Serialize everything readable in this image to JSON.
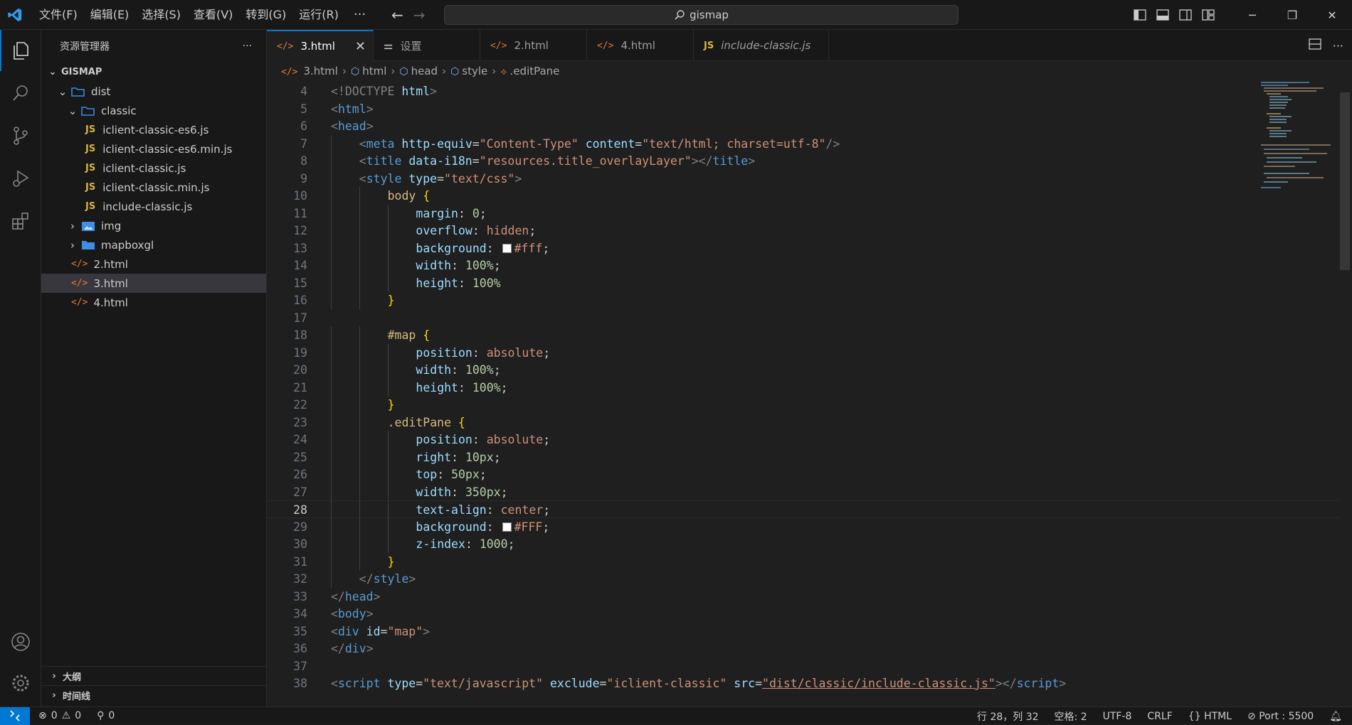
{
  "titlebar": {
    "menu": [
      "文件(F)",
      "编辑(E)",
      "选择(S)",
      "查看(V)",
      "转到(G)",
      "运行(R)"
    ],
    "more": "···",
    "search_text": "gismap"
  },
  "explorer": {
    "title": "资源管理器",
    "more": "···",
    "root": "GISMAP",
    "tree": [
      {
        "label": "dist",
        "type": "folder-open",
        "level": 1
      },
      {
        "label": "classic",
        "type": "folder-open",
        "level": 2
      },
      {
        "label": "iclient-classic-es6.js",
        "type": "js",
        "level": 3
      },
      {
        "label": "iclient-classic-es6.min.js",
        "type": "js",
        "level": 3
      },
      {
        "label": "iclient-classic.js",
        "type": "js",
        "level": 3
      },
      {
        "label": "iclient-classic.min.js",
        "type": "js",
        "level": 3
      },
      {
        "label": "include-classic.js",
        "type": "js",
        "level": 3
      },
      {
        "label": "img",
        "type": "folder-img",
        "level": 2
      },
      {
        "label": "mapboxgl",
        "type": "folder",
        "level": 2
      },
      {
        "label": "2.html",
        "type": "html",
        "level": 2
      },
      {
        "label": "3.html",
        "type": "html",
        "level": 2,
        "selected": true
      },
      {
        "label": "4.html",
        "type": "html",
        "level": 2
      }
    ],
    "outline": "大纲",
    "timeline": "时间线"
  },
  "tabs": [
    {
      "label": "3.html",
      "type": "html",
      "active": true
    },
    {
      "label": "设置",
      "type": "settings"
    },
    {
      "label": "2.html",
      "type": "html"
    },
    {
      "label": "4.html",
      "type": "html"
    },
    {
      "label": "include-classic.js",
      "type": "js",
      "italic": true
    }
  ],
  "breadcrumb": [
    "3.html",
    "html",
    "head",
    "style",
    ".editPane"
  ],
  "editor": {
    "current_line": 28,
    "lines": [
      {
        "n": "4",
        "indent": 0,
        "tokens": [
          [
            "<!DOCTYPE ",
            "#808080"
          ],
          [
            "html",
            "#9cdcfe"
          ],
          [
            ">",
            "#808080"
          ]
        ]
      },
      {
        "n": "5",
        "indent": 0,
        "tokens": [
          [
            "<",
            "#808080"
          ],
          [
            "html",
            "#569cd6"
          ],
          [
            ">",
            "#808080"
          ]
        ]
      },
      {
        "n": "6",
        "indent": 0,
        "tokens": [
          [
            "<",
            "#808080"
          ],
          [
            "head",
            "#569cd6"
          ],
          [
            ">",
            "#808080"
          ]
        ]
      },
      {
        "n": "7",
        "indent": 1,
        "tokens": [
          [
            "<",
            "#808080"
          ],
          [
            "meta",
            "#569cd6"
          ],
          [
            " http-equiv",
            "#9cdcfe"
          ],
          [
            "=",
            "#cccccc"
          ],
          [
            "\"Content-Type\"",
            "#ce9178"
          ],
          [
            " content",
            "#9cdcfe"
          ],
          [
            "=",
            "#cccccc"
          ],
          [
            "\"text/html; charset=utf-8\"",
            "#ce9178"
          ],
          [
            "/>",
            "#808080"
          ]
        ]
      },
      {
        "n": "8",
        "indent": 1,
        "tokens": [
          [
            "<",
            "#808080"
          ],
          [
            "title",
            "#569cd6"
          ],
          [
            " data-i18n",
            "#9cdcfe"
          ],
          [
            "=",
            "#cccccc"
          ],
          [
            "\"resources.title_overlayLayer\"",
            "#ce9178"
          ],
          [
            "></",
            "#808080"
          ],
          [
            "title",
            "#569cd6"
          ],
          [
            ">",
            "#808080"
          ]
        ]
      },
      {
        "n": "9",
        "indent": 1,
        "tokens": [
          [
            "<",
            "#808080"
          ],
          [
            "style",
            "#569cd6"
          ],
          [
            " type",
            "#9cdcfe"
          ],
          [
            "=",
            "#cccccc"
          ],
          [
            "\"text/css\"",
            "#ce9178"
          ],
          [
            ">",
            "#808080"
          ]
        ]
      },
      {
        "n": "10",
        "indent": 2,
        "tokens": [
          [
            "body",
            "#d7ba7d"
          ],
          [
            " {",
            "#ffd700"
          ]
        ]
      },
      {
        "n": "11",
        "indent": 3,
        "tokens": [
          [
            "margin",
            "#9cdcfe"
          ],
          [
            ": ",
            "#cccccc"
          ],
          [
            "0",
            "#b5cea8"
          ],
          [
            ";",
            "#cccccc"
          ]
        ]
      },
      {
        "n": "12",
        "indent": 3,
        "tokens": [
          [
            "overflow",
            "#9cdcfe"
          ],
          [
            ": ",
            "#cccccc"
          ],
          [
            "hidden",
            "#ce9178"
          ],
          [
            ";",
            "#cccccc"
          ]
        ]
      },
      {
        "n": "13",
        "indent": 3,
        "swatch": "#ffffff",
        "tokens": [
          [
            "background",
            "#9cdcfe"
          ],
          [
            ": ",
            "#cccccc"
          ],
          [
            "SWATCH",
            ""
          ],
          [
            "#fff",
            "#ce9178"
          ],
          [
            ";",
            "#cccccc"
          ]
        ]
      },
      {
        "n": "14",
        "indent": 3,
        "tokens": [
          [
            "width",
            "#9cdcfe"
          ],
          [
            ": ",
            "#cccccc"
          ],
          [
            "100%",
            "#b5cea8"
          ],
          [
            ";",
            "#cccccc"
          ]
        ]
      },
      {
        "n": "15",
        "indent": 3,
        "tokens": [
          [
            "height",
            "#9cdcfe"
          ],
          [
            ": ",
            "#cccccc"
          ],
          [
            "100%",
            "#b5cea8"
          ]
        ]
      },
      {
        "n": "16",
        "indent": 2,
        "tokens": [
          [
            "}",
            "#ffd700"
          ]
        ]
      },
      {
        "n": "17",
        "indent": 0,
        "tokens": []
      },
      {
        "n": "18",
        "indent": 2,
        "tokens": [
          [
            "#map",
            "#d7ba7d"
          ],
          [
            " {",
            "#ffd700"
          ]
        ]
      },
      {
        "n": "19",
        "indent": 3,
        "tokens": [
          [
            "position",
            "#9cdcfe"
          ],
          [
            ": ",
            "#cccccc"
          ],
          [
            "absolute",
            "#ce9178"
          ],
          [
            ";",
            "#cccccc"
          ]
        ]
      },
      {
        "n": "20",
        "indent": 3,
        "tokens": [
          [
            "width",
            "#9cdcfe"
          ],
          [
            ": ",
            "#cccccc"
          ],
          [
            "100%",
            "#b5cea8"
          ],
          [
            ";",
            "#cccccc"
          ]
        ]
      },
      {
        "n": "21",
        "indent": 3,
        "tokens": [
          [
            "height",
            "#9cdcfe"
          ],
          [
            ": ",
            "#cccccc"
          ],
          [
            "100%",
            "#b5cea8"
          ],
          [
            ";",
            "#cccccc"
          ]
        ]
      },
      {
        "n": "22",
        "indent": 2,
        "tokens": [
          [
            "}",
            "#ffd700"
          ]
        ]
      },
      {
        "n": "23",
        "indent": 2,
        "tokens": [
          [
            ".editPane",
            "#d7ba7d"
          ],
          [
            " {",
            "#ffd700"
          ]
        ]
      },
      {
        "n": "24",
        "indent": 3,
        "tokens": [
          [
            "position",
            "#9cdcfe"
          ],
          [
            ": ",
            "#cccccc"
          ],
          [
            "absolute",
            "#ce9178"
          ],
          [
            ";",
            "#cccccc"
          ]
        ]
      },
      {
        "n": "25",
        "indent": 3,
        "tokens": [
          [
            "right",
            "#9cdcfe"
          ],
          [
            ": ",
            "#cccccc"
          ],
          [
            "10px",
            "#b5cea8"
          ],
          [
            ";",
            "#cccccc"
          ]
        ]
      },
      {
        "n": "26",
        "indent": 3,
        "tokens": [
          [
            "top",
            "#9cdcfe"
          ],
          [
            ": ",
            "#cccccc"
          ],
          [
            "50px",
            "#b5cea8"
          ],
          [
            ";",
            "#cccccc"
          ]
        ]
      },
      {
        "n": "27",
        "indent": 3,
        "tokens": [
          [
            "width",
            "#9cdcfe"
          ],
          [
            ": ",
            "#cccccc"
          ],
          [
            "350px",
            "#b5cea8"
          ],
          [
            ";",
            "#cccccc"
          ]
        ]
      },
      {
        "n": "28",
        "indent": 3,
        "tokens": [
          [
            "text-align",
            "#9cdcfe"
          ],
          [
            ": ",
            "#cccccc"
          ],
          [
            "center",
            "#ce9178"
          ],
          [
            ";",
            "#cccccc"
          ]
        ]
      },
      {
        "n": "29",
        "indent": 3,
        "swatch": "#ffffff",
        "tokens": [
          [
            "background",
            "#9cdcfe"
          ],
          [
            ": ",
            "#cccccc"
          ],
          [
            "SWATCH",
            ""
          ],
          [
            "#FFF",
            "#ce9178"
          ],
          [
            ";",
            "#cccccc"
          ]
        ]
      },
      {
        "n": "30",
        "indent": 3,
        "tokens": [
          [
            "z-index",
            "#9cdcfe"
          ],
          [
            ": ",
            "#cccccc"
          ],
          [
            "1000",
            "#b5cea8"
          ],
          [
            ";",
            "#cccccc"
          ]
        ]
      },
      {
        "n": "31",
        "indent": 2,
        "tokens": [
          [
            "}",
            "#ffd700"
          ]
        ]
      },
      {
        "n": "32",
        "indent": 1,
        "tokens": [
          [
            "</",
            "#808080"
          ],
          [
            "style",
            "#569cd6"
          ],
          [
            ">",
            "#808080"
          ]
        ]
      },
      {
        "n": "33",
        "indent": 0,
        "tokens": [
          [
            "</",
            "#808080"
          ],
          [
            "head",
            "#569cd6"
          ],
          [
            ">",
            "#808080"
          ]
        ]
      },
      {
        "n": "34",
        "indent": 0,
        "tokens": [
          [
            "<",
            "#808080"
          ],
          [
            "body",
            "#569cd6"
          ],
          [
            ">",
            "#808080"
          ]
        ]
      },
      {
        "n": "35",
        "indent": 0,
        "tokens": [
          [
            "<",
            "#808080"
          ],
          [
            "div",
            "#569cd6"
          ],
          [
            " id",
            "#9cdcfe"
          ],
          [
            "=",
            "#cccccc"
          ],
          [
            "\"map\"",
            "#ce9178"
          ],
          [
            ">",
            "#808080"
          ]
        ]
      },
      {
        "n": "36",
        "indent": 0,
        "tokens": [
          [
            "</",
            "#808080"
          ],
          [
            "div",
            "#569cd6"
          ],
          [
            ">",
            "#808080"
          ]
        ]
      },
      {
        "n": "37",
        "indent": 0,
        "tokens": []
      },
      {
        "n": "38",
        "indent": 0,
        "tokens": [
          [
            "<",
            "#808080"
          ],
          [
            "script",
            "#569cd6"
          ],
          [
            " type",
            "#9cdcfe"
          ],
          [
            "=",
            "#cccccc"
          ],
          [
            "\"text/javascript\"",
            "#ce9178"
          ],
          [
            " exclude",
            "#9cdcfe"
          ],
          [
            "=",
            "#cccccc"
          ],
          [
            "\"iclient-classic\"",
            "#ce9178"
          ],
          [
            " src",
            "#9cdcfe"
          ],
          [
            "=",
            "#cccccc"
          ],
          [
            "\"dist/classic/include-classic.js\"",
            "#ce9178"
          ],
          [
            "></",
            "#808080"
          ],
          [
            "script",
            "#569cd6"
          ],
          [
            ">",
            "#808080"
          ]
        ]
      }
    ]
  },
  "statusbar": {
    "errors": "0",
    "warnings": "0",
    "ports": "0",
    "position": "行 28，列 32",
    "spaces": "空格: 2",
    "encoding": "UTF-8",
    "eol": "CRLF",
    "language": "HTML",
    "port": "Port : 5500"
  },
  "colors": {
    "accent": "#0078d4",
    "js_icon": "#d8b341",
    "html_icon": "#e37933",
    "folder": "#3d8ee6"
  }
}
